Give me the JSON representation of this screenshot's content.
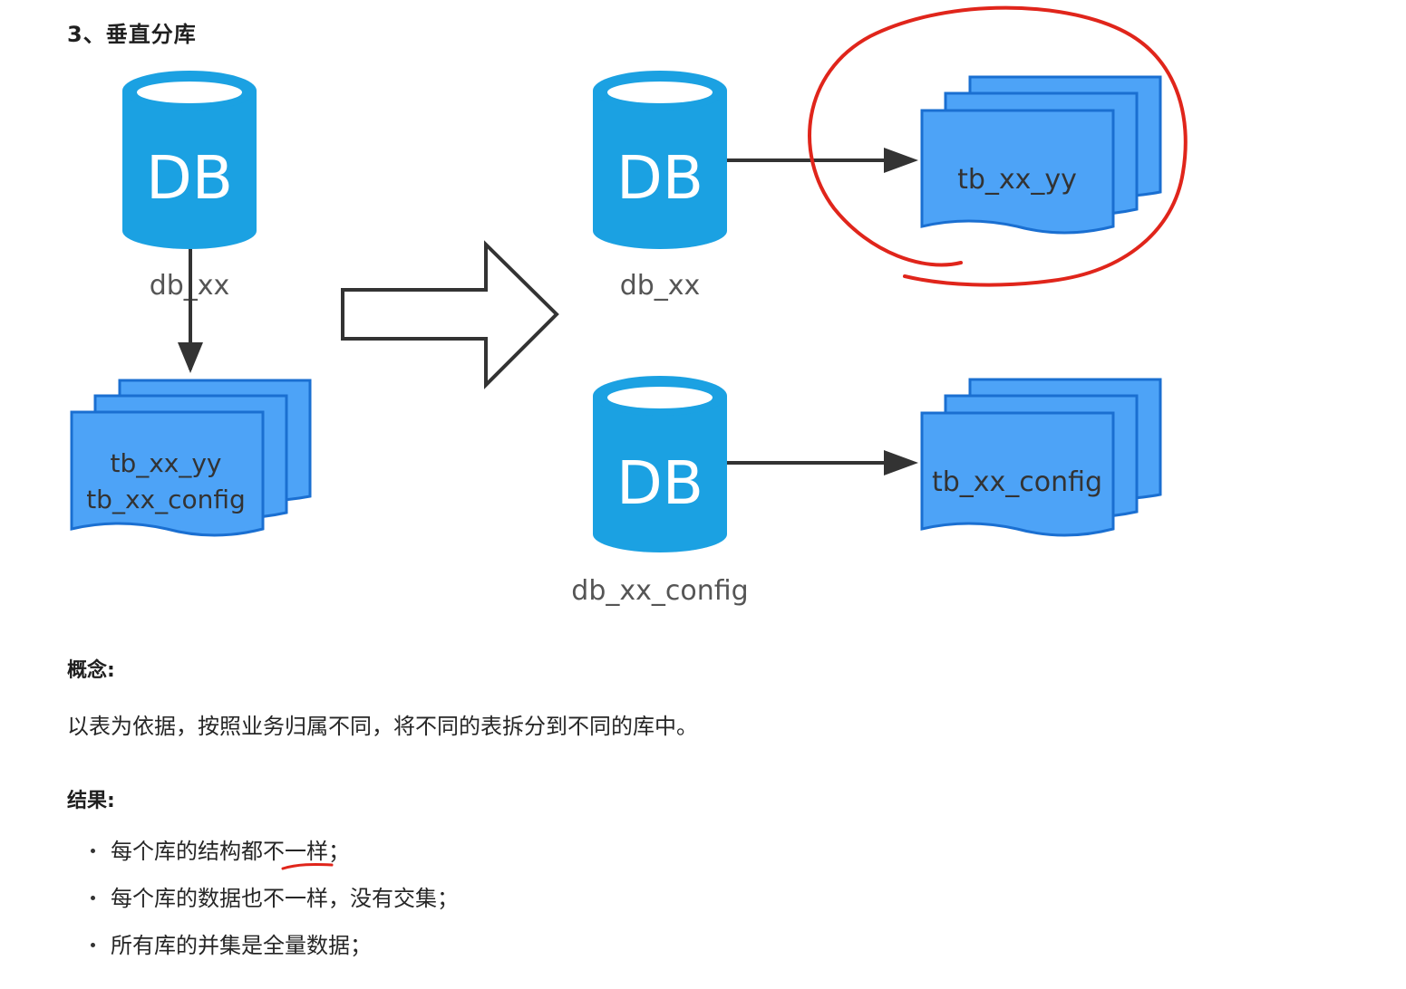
{
  "heading": "3、垂直分库",
  "diagram": {
    "db_text": "DB",
    "left_db_label": "db_xx",
    "left_tables_line1": "tb_xx_yy",
    "left_tables_line2": "tb_xx_config",
    "right_top_db_label": "db_xx",
    "right_top_tables": "tb_xx_yy",
    "right_bottom_db_label": "db_xx_config",
    "right_bottom_tables": "tb_xx_config"
  },
  "colors": {
    "db_blue": "#1ba1e2",
    "table_blue": "#4da3f7",
    "table_border": "#1a6fd1",
    "annotation_red": "#e0251b"
  },
  "concept": {
    "label": "概念:",
    "text": "以表为依据，按照业务归属不同，将不同的表拆分到不同的库中。"
  },
  "result": {
    "label": "结果:",
    "items": [
      "每个库的结构都不一样；",
      "每个库的数据也不一样，没有交集；",
      "所有库的并集是全量数据；"
    ]
  }
}
